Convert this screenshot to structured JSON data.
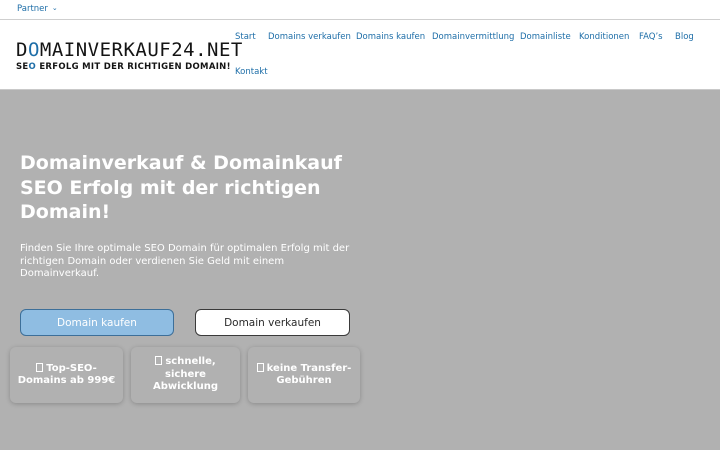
{
  "topbar": {
    "partner_label": "Partner"
  },
  "logo": {
    "main_prefix": "D",
    "main_o": "O",
    "main_rest": "MAINVERKAUF24.NET",
    "sub_prefix": "SE",
    "sub_o": "O",
    "sub_rest": " ERFOLG MIT DER RICHTIGEN DOMAIN!"
  },
  "nav": {
    "items": [
      {
        "label": "Start"
      },
      {
        "label": "Domains verkaufen"
      },
      {
        "label": "Domains kaufen"
      },
      {
        "label": "Domainvermittlung"
      },
      {
        "label": "Domainliste"
      },
      {
        "label": "Konditionen"
      },
      {
        "label": "FAQ’s"
      },
      {
        "label": "Blog"
      },
      {
        "label": "Kontakt"
      }
    ]
  },
  "hero": {
    "title": "Domainverkauf & Domainkauf SEO Erfolg mit der richtigen Domain!",
    "text": "Finden Sie Ihre optimale SEO Domain für optimalen Erfolg mit der richtigen Domain oder verdienen Sie Geld mit einem Domainverkauf.",
    "buy_button": "Domain kaufen",
    "sell_button": "Domain verkaufen"
  },
  "features": [
    {
      "text": "Top-SEO-Domains ab 999€"
    },
    {
      "text": "schnelle, sichere Abwicklung"
    },
    {
      "text": "keine Transfer-Gebühren"
    }
  ],
  "colors": {
    "accent": "#1e6ea8",
    "hero_bg": "#b1b1b1",
    "buy_button": "#8fbde2"
  }
}
